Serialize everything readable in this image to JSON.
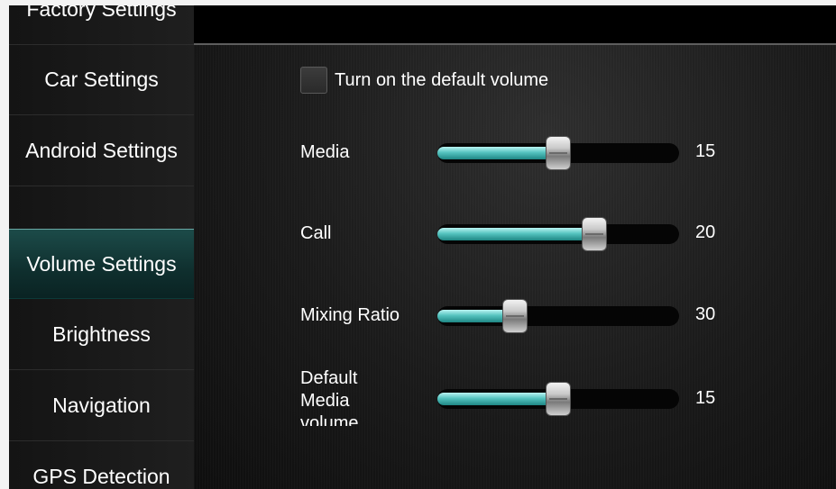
{
  "sidebar": {
    "items": [
      {
        "label": "Factory Settings"
      },
      {
        "label": "Car Settings"
      },
      {
        "label": "Android Settings"
      },
      {
        "label": "Volume Settings",
        "active": true
      },
      {
        "label": "Brightness"
      },
      {
        "label": "Navigation"
      },
      {
        "label": "GPS Detection"
      }
    ]
  },
  "volume": {
    "default_toggle": {
      "label": "Turn on the default volume",
      "checked": false
    },
    "sliders": [
      {
        "label": "Media",
        "value": "15",
        "fill_fraction": 0.5
      },
      {
        "label": "Call",
        "value": "20",
        "fill_fraction": 0.65
      },
      {
        "label": "Mixing Ratio",
        "value": "30",
        "fill_fraction": 0.32
      },
      {
        "label": "Default Media volume",
        "label_lines": [
          "Default",
          "Media",
          "volume"
        ],
        "value": "15",
        "fill_fraction": 0.5
      }
    ]
  },
  "colors": {
    "accent": "#55c4c0",
    "active_item": "#1c4b49",
    "background": "#000000"
  }
}
